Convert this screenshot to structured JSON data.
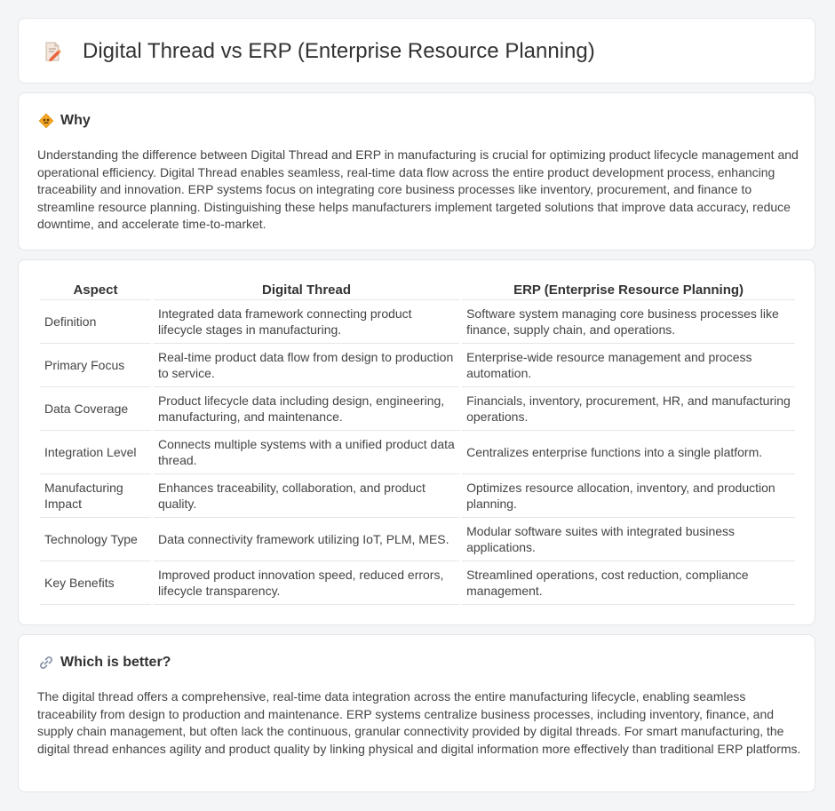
{
  "page": {
    "title": "Digital Thread vs ERP (Enterprise Resource Planning)",
    "title_icon": "document-pencil-icon"
  },
  "why": {
    "heading": "Why",
    "icon": "diamond-sign-icon",
    "text": "Understanding the difference between Digital Thread and ERP in manufacturing is crucial for optimizing product lifecycle management and operational efficiency. Digital Thread enables seamless, real-time data flow across the entire product development process, enhancing traceability and innovation. ERP systems focus on integrating core business processes like inventory, procurement, and finance to streamline resource planning. Distinguishing these helps manufacturers implement targeted solutions that improve data accuracy, reduce downtime, and accelerate time-to-market."
  },
  "table": {
    "headers": [
      "Aspect",
      "Digital Thread",
      "ERP (Enterprise Resource Planning)"
    ],
    "rows": [
      [
        "Definition",
        "Integrated data framework connecting product lifecycle stages in manufacturing.",
        "Software system managing core business processes like finance, supply chain, and operations."
      ],
      [
        "Primary Focus",
        "Real-time product data flow from design to production to service.",
        "Enterprise-wide resource management and process automation."
      ],
      [
        "Data Coverage",
        "Product lifecycle data including design, engineering, manufacturing, and maintenance.",
        "Financials, inventory, procurement, HR, and manufacturing operations."
      ],
      [
        "Integration Level",
        "Connects multiple systems with a unified product data thread.",
        "Centralizes enterprise functions into a single platform."
      ],
      [
        "Manufacturing Impact",
        "Enhances traceability, collaboration, and product quality.",
        "Optimizes resource allocation, inventory, and production planning."
      ],
      [
        "Technology Type",
        "Data connectivity framework utilizing IoT, PLM, MES.",
        "Modular software suites with integrated business applications."
      ],
      [
        "Key Benefits",
        "Improved product innovation speed, reduced errors, lifecycle transparency.",
        "Streamlined operations, cost reduction, compliance management."
      ]
    ]
  },
  "better": {
    "heading": "Which is better?",
    "icon": "link-icon",
    "text": "The digital thread offers a comprehensive, real-time data integration across the entire manufacturing lifecycle, enabling seamless traceability from design to production and maintenance. ERP systems centralize business processes, including inventory, finance, and supply chain management, but often lack the continuous, granular connectivity provided by digital threads. For smart manufacturing, the digital thread enhances agility and product quality by linking physical and digital information more effectively than traditional ERP platforms."
  }
}
